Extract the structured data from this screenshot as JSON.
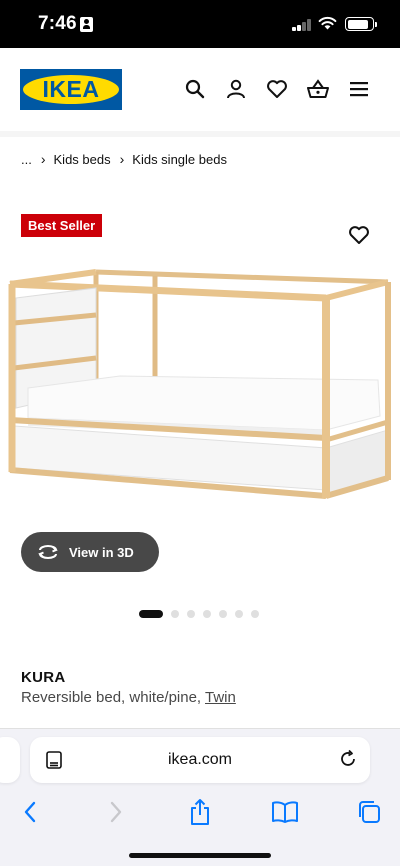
{
  "status_bar": {
    "time": "7:46",
    "signal_bars_active": 2,
    "signal_bars_total": 4,
    "battery_level": 0.75
  },
  "header": {
    "logo_text": "IKEA",
    "icons": [
      "search-icon",
      "account-icon",
      "favourites-icon",
      "shopping-basket-icon",
      "menu-icon"
    ]
  },
  "breadcrumb": {
    "items": [
      "...",
      "Kids beds",
      "Kids single beds"
    ]
  },
  "product": {
    "badge": "Best Seller",
    "view_3d_label": "View in 3D",
    "gallery_total": 7,
    "gallery_current": 1,
    "name": "KURA",
    "description": "Reversible bed, white/pine,",
    "size_link": "Twin"
  },
  "browser": {
    "url": "ikea.com"
  },
  "colors": {
    "ikea_blue": "#0058a3",
    "ikea_yellow": "#ffdb00",
    "badge_red": "#cc0008",
    "ios_blue": "#0a7aff"
  }
}
